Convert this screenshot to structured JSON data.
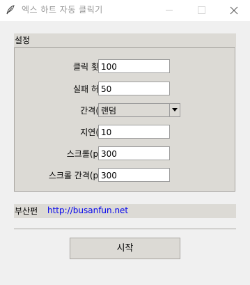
{
  "window": {
    "title": "엑스 하트 자동 클릭기",
    "icons": {
      "app": "feather-icon",
      "minimize": "minimize-icon",
      "maximize": "maximize-icon",
      "close": "close-icon"
    }
  },
  "settings": {
    "section_label": "설정",
    "rows": [
      {
        "label": "클릭 횟수:",
        "value": "100"
      },
      {
        "label": "실패 허용:",
        "value": "50"
      },
      {
        "label": "간격(s):",
        "value": "랜덤",
        "type": "combobox"
      },
      {
        "label": "지연(s):",
        "value": "10"
      },
      {
        "label": "스크롤(px):",
        "value": "300"
      },
      {
        "label": "스크롤 간격(px):",
        "value": "300"
      }
    ]
  },
  "author": {
    "label": "부산펀",
    "link_text": "http://busanfun.net"
  },
  "actions": {
    "start_label": "시작"
  },
  "colors": {
    "background": "#f0f0f0",
    "frame": "#dcdad5",
    "link": "#0000ee"
  }
}
